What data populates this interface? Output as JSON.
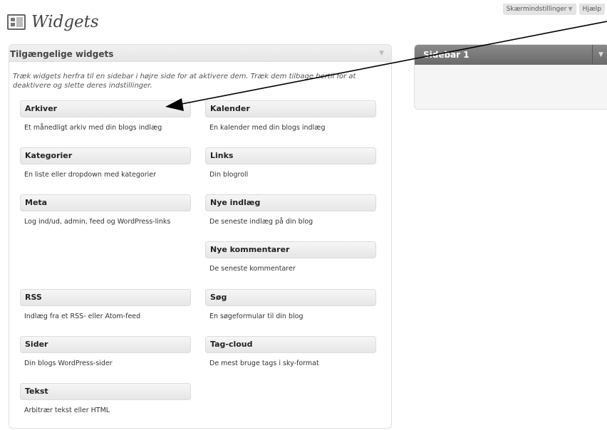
{
  "top_links": {
    "screen_options": "Skærmindstillinger",
    "help": "Hjælp"
  },
  "page": {
    "title": "Widgets"
  },
  "available_widgets": {
    "title": "Tilgængelige widgets",
    "description": "Træk widgets herfra til en sidebar i højre side for at aktivere dem. Træk dem tilbage hertil for at deaktivere og slette deres indstillinger.",
    "items": [
      {
        "title": "Arkiver",
        "desc": "Et månedligt arkiv med din blogs indlæg"
      },
      {
        "title": "Kalender",
        "desc": "En kalender med din blogs indlæg"
      },
      {
        "title": "Kategorier",
        "desc": "En liste eller dropdown med kategorier"
      },
      {
        "title": "Links",
        "desc": "Din blogroll"
      },
      {
        "title": "Meta",
        "desc": "Log ind/ud, admin, feed og WordPress-links"
      },
      {
        "title": "Nye indlæg",
        "desc": "De seneste indlæg på din blog"
      },
      {
        "title": "Nye kommentarer",
        "desc": "De seneste kommentarer"
      },
      {
        "title": "RSS",
        "desc": "Indlæg fra et RSS- eller Atom-feed"
      },
      {
        "title": "Søg",
        "desc": "En søgeformular til din blog"
      },
      {
        "title": "Sider",
        "desc": "Din blogs WordPress-sider"
      },
      {
        "title": "Tag-cloud",
        "desc": "De mest bruge tags i sky-format"
      },
      {
        "title": "Tekst",
        "desc": "Arbitrær tekst eller HTML"
      }
    ]
  },
  "sidebar": {
    "title": "Sidebar 1"
  },
  "icons": {
    "page_icon": "widgets-icon",
    "toggle": "triangle-down-icon"
  }
}
